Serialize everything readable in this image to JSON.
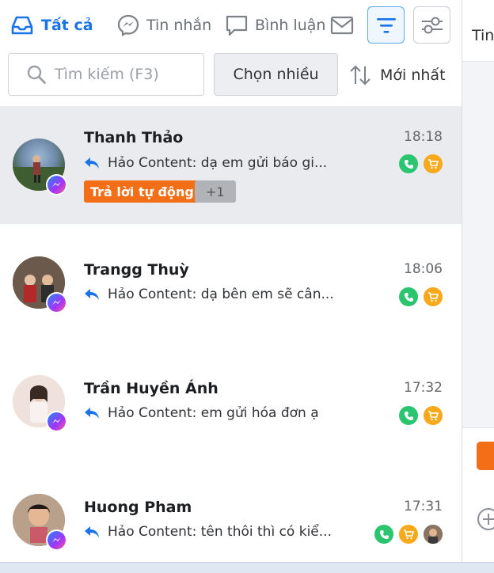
{
  "tabs": {
    "all": "Tất cả",
    "messages": "Tin nhắn",
    "comments": "Bình luận"
  },
  "search": {
    "placeholder": "Tìm kiếm (F3)"
  },
  "toolbar": {
    "multi_select_label": "Chọn nhiều",
    "sort_label": "Mới nhất"
  },
  "right_panel": {
    "tab_label": "Tin"
  },
  "colors": {
    "accent": "#1a73e8",
    "selected_row": "#e9ebee",
    "auto_reply_tag": "#f36f17",
    "phone_status": "#2bc46f",
    "order_status": "#f7a81b"
  },
  "conversations": [
    {
      "name": "Thanh Thảo",
      "time": "18:18",
      "preview": "Hảo Content: dạ em gửi báo gi...",
      "tags": [
        "Trả lời tự động",
        "+1"
      ],
      "selected": true
    },
    {
      "name": "Trangg Thuỳ",
      "time": "18:06",
      "preview": "Hảo Content: dạ bên em sẽ cân...",
      "tags": [],
      "selected": false
    },
    {
      "name": "Trần Huyền Ánh",
      "time": "17:32",
      "preview": "Hảo Content: em gửi hóa đơn ạ",
      "tags": [],
      "selected": false
    },
    {
      "name": "Huong Pham",
      "time": "17:31",
      "preview": "Hảo Content: tên thôi thì có kiể...",
      "tags": [],
      "selected": false
    }
  ]
}
